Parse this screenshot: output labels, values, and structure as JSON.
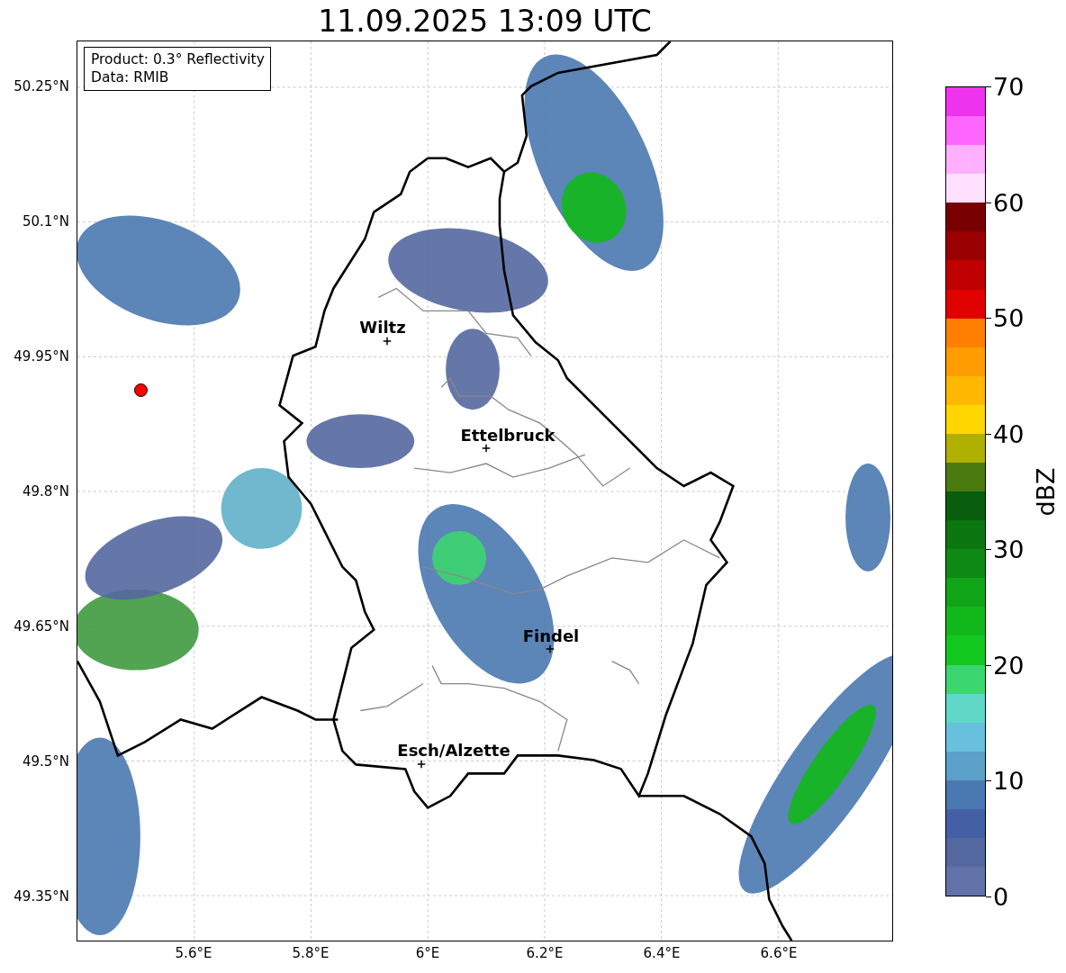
{
  "title": "11.09.2025 13:09 UTC",
  "legend": {
    "lines": [
      "Product: 0.3° Reflectivity",
      "Data: RMIB"
    ]
  },
  "map": {
    "y_ticks": [
      "50.25°N",
      "50.1°N",
      "49.95°N",
      "49.8°N",
      "49.65°N",
      "49.5°N",
      "49.35°N"
    ],
    "x_ticks": [
      "5.6°E",
      "5.8°E",
      "6°E",
      "6.2°E",
      "6.4°E",
      "6.6°E"
    ],
    "cities": [
      {
        "name": "Wiltz"
      },
      {
        "name": "Ettelbruck"
      },
      {
        "name": "Findel"
      },
      {
        "name": "Esch/Alzette"
      }
    ]
  },
  "colorbar": {
    "label": "dBZ",
    "ticks": [
      "70",
      "60",
      "50",
      "40",
      "30",
      "20",
      "10",
      "0"
    ],
    "bands": [
      {
        "color": "#ee33ee"
      },
      {
        "color": "#ff66ff"
      },
      {
        "color": "#ffb0ff"
      },
      {
        "color": "#ffe0ff"
      },
      {
        "color": "#780000"
      },
      {
        "color": "#9a0000"
      },
      {
        "color": "#c00000"
      },
      {
        "color": "#e00000"
      },
      {
        "color": "#ff8000"
      },
      {
        "color": "#ff9c00"
      },
      {
        "color": "#ffb800"
      },
      {
        "color": "#ffd600"
      },
      {
        "color": "#b0b000"
      },
      {
        "color": "#4a7a10"
      },
      {
        "color": "#085e0c"
      },
      {
        "color": "#0c7610"
      },
      {
        "color": "#0e8a14"
      },
      {
        "color": "#10a418"
      },
      {
        "color": "#12b81a"
      },
      {
        "color": "#12c81e"
      },
      {
        "color": "#3cd670"
      },
      {
        "color": "#60d8c8"
      },
      {
        "color": "#68c0dc"
      },
      {
        "color": "#5aa0c8"
      },
      {
        "color": "#4a78b0"
      },
      {
        "color": "#4460a4"
      },
      {
        "color": "#5468a0"
      },
      {
        "color": "#6272a8"
      }
    ]
  }
}
